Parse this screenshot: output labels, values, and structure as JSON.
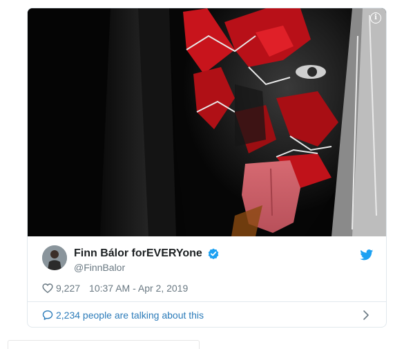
{
  "tweet": {
    "display_name": "Finn Bálor forEVERYone",
    "handle": "@FinnBalor",
    "likes": "9,227",
    "timestamp": "10:37 AM - Apr 2, 2019",
    "talking": "2,234 people are talking about this"
  },
  "media": {
    "info_glyph": "i"
  },
  "icons": {
    "verified": "verified-badge-icon",
    "twitter": "twitter-bird-icon",
    "heart": "heart-icon",
    "bubble": "comment-bubble-icon",
    "chevron": "chevron-right-icon"
  },
  "colors": {
    "accent": "#1da1f2",
    "link": "#2b7bb9",
    "paint_red": "#c8141c"
  }
}
